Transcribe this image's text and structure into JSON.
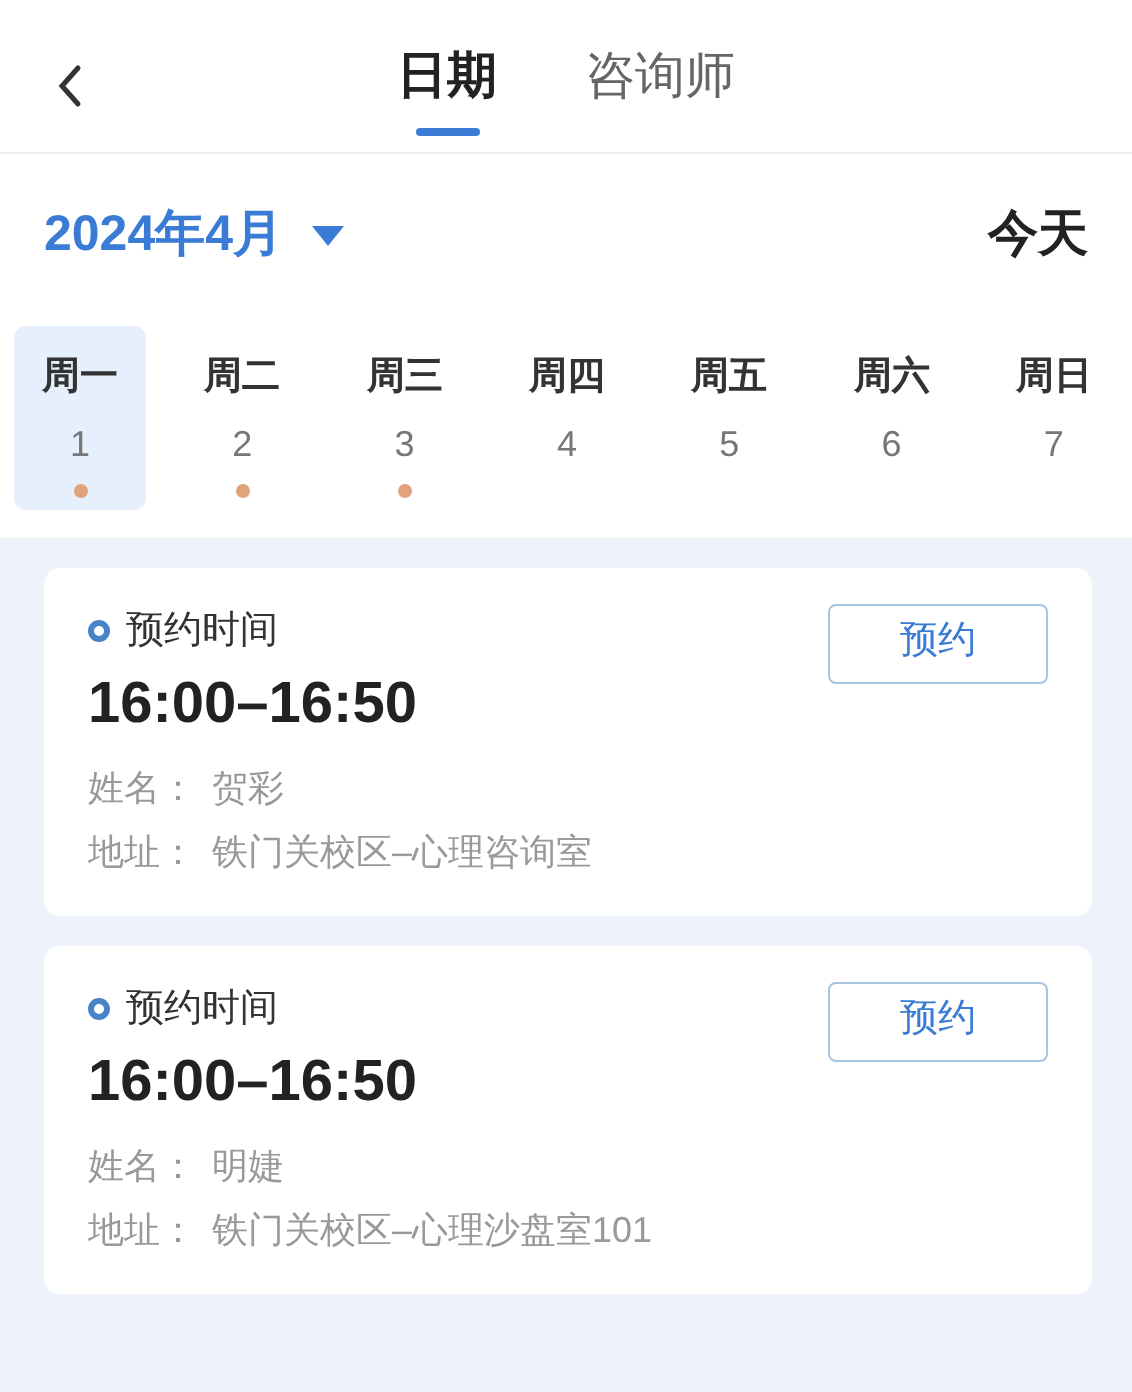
{
  "header": {
    "tabs": [
      {
        "label": "日期",
        "selected": true
      },
      {
        "label": "咨询师",
        "selected": false
      }
    ]
  },
  "calendar": {
    "month": "2024年4月",
    "today": "今天",
    "days": [
      {
        "weekday": "周一",
        "date": "1",
        "selected": true,
        "has_booking": true
      },
      {
        "weekday": "周二",
        "date": "2",
        "selected": false,
        "has_booking": true
      },
      {
        "weekday": "周三",
        "date": "3",
        "selected": false,
        "has_booking": true
      },
      {
        "weekday": "周四",
        "date": "4",
        "selected": false,
        "has_booking": false
      },
      {
        "weekday": "周五",
        "date": "5",
        "selected": false,
        "has_booking": false
      },
      {
        "weekday": "周六",
        "date": "6",
        "selected": false,
        "has_booking": false
      },
      {
        "weekday": "周日",
        "date": "7",
        "selected": false,
        "has_booking": false
      }
    ]
  },
  "appointments": [
    {
      "heading": "预约时间",
      "time": "16:00–16:50",
      "name_label": "姓名：",
      "name": "贺彩",
      "address_label": "地址：",
      "address": "铁门关校区–心理咨询室",
      "button": "预约"
    },
    {
      "heading": "预约时间",
      "time": "16:00–16:50",
      "name_label": "姓名：",
      "name": "明婕",
      "address_label": "地址：",
      "address": "铁门关校区–心理沙盘室101",
      "button": "预约"
    }
  ]
}
